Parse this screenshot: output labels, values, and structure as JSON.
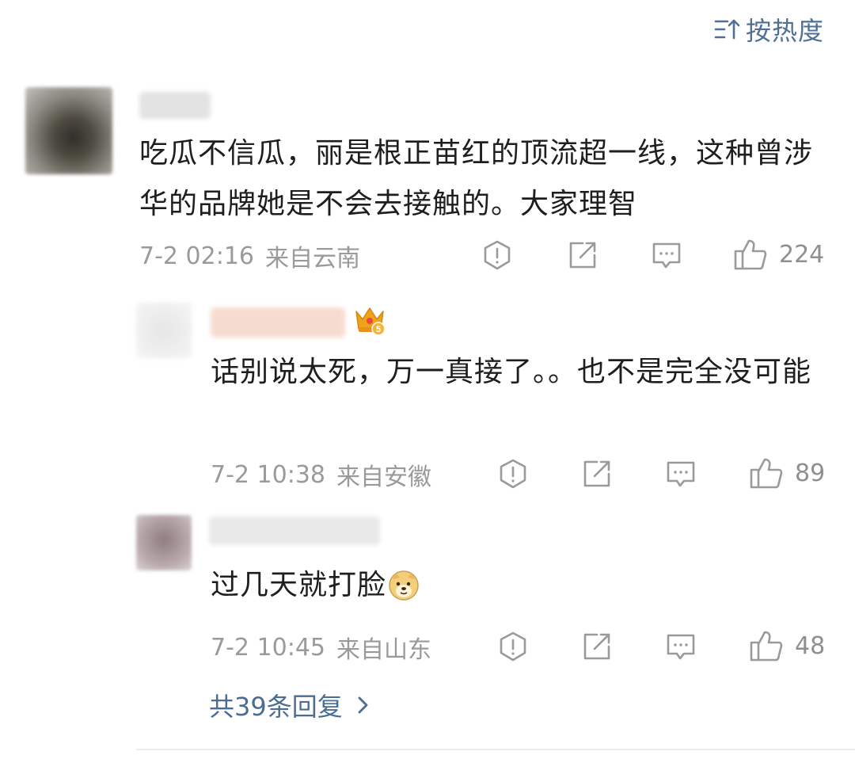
{
  "sort": {
    "label": "按热度",
    "icon": "sort-icon"
  },
  "comment": {
    "text": "吃瓜不信瓜，丽是根正苗红的顶流超一线，这种曾涉华的品牌她是不会去接触的。大家理智",
    "time": "7-2 02:16",
    "location": "来自云南",
    "likes": "224"
  },
  "replies": [
    {
      "text": "话别说太死，万一真接了。。也不是完全没可能",
      "badge_icon": "crown-badge-icon",
      "time": "7-2 10:38",
      "location": "来自安徽",
      "likes": "89"
    },
    {
      "text": "过几天就打脸",
      "emoji_icon": "doge-emoji-icon",
      "time": "7-2 10:45",
      "location": "来自山东",
      "likes": "48"
    }
  ],
  "more_replies_label": "共39条回复",
  "colors": {
    "link": "#4b6d93",
    "meta": "#9a9a9a",
    "text": "#1e1e1e",
    "crown": "#f0a31a"
  }
}
